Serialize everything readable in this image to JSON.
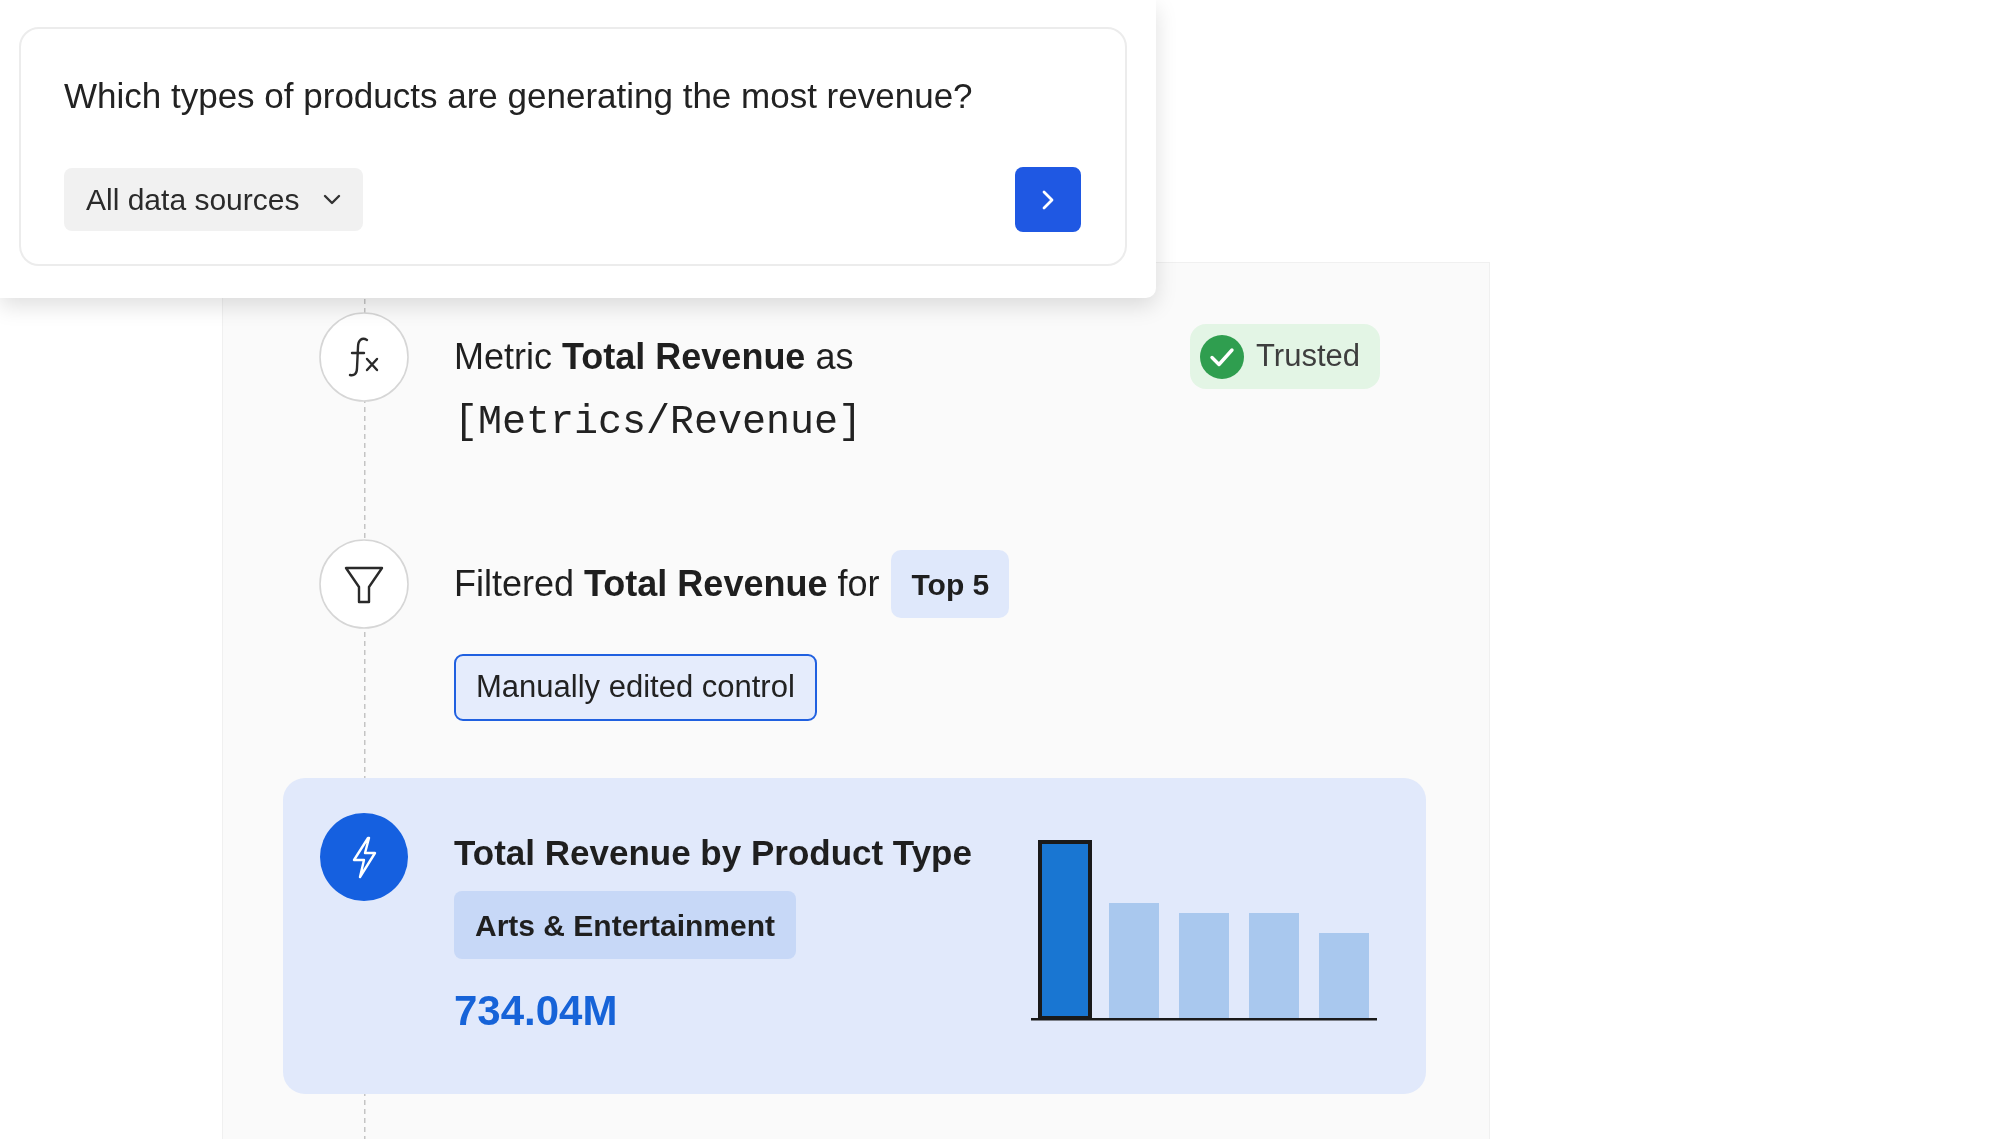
{
  "query": {
    "question": "Which types of products are generating the most revenue?",
    "source_dropdown": "All data sources"
  },
  "steps": [
    {
      "kind": "metric",
      "selected": false,
      "text": "Metric **Total Revenue** as",
      "expression": "[Metrics/Revenue]",
      "badge": "Trusted"
    },
    {
      "kind": "filter",
      "selected": false,
      "text": "Filtered **Total Revenue** for",
      "tag": "Top 5",
      "control": "Manually edited control"
    },
    {
      "kind": "result",
      "selected": true,
      "title": "Total Revenue by Product Type",
      "category": "Arts & Entertainment",
      "value": "734.04M"
    }
  ]
}
